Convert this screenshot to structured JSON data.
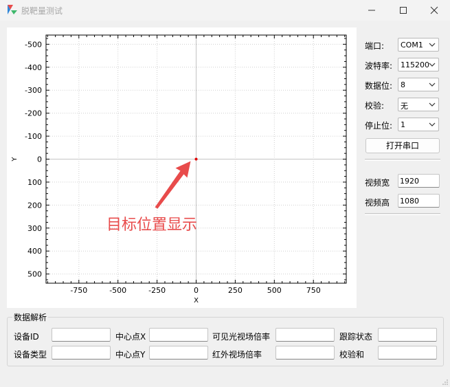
{
  "window": {
    "title": "脱靶量测试"
  },
  "chart_data": {
    "type": "scatter",
    "title": "",
    "xlabel": "X",
    "ylabel": "Y",
    "xlim": [
      -960,
      960
    ],
    "ylim": [
      540,
      -540
    ],
    "y_inverted": true,
    "grid": true,
    "xticks": [
      -750,
      -500,
      -250,
      0,
      250,
      500,
      750
    ],
    "yticks": [
      -500,
      -400,
      -300,
      -200,
      -100,
      0,
      100,
      200,
      300,
      400,
      500
    ],
    "points": [
      {
        "x": 0,
        "y": 0
      }
    ],
    "annotation": "目标位置显示",
    "annotation_color": "#e84b4b",
    "point_color": "#e00000"
  },
  "serial": {
    "port_label": "端口:",
    "port_value": "COM1",
    "baud_label": "波特率:",
    "baud_value": "115200",
    "databits_label": "数据位:",
    "databits_value": "8",
    "parity_label": "校验:",
    "parity_value": "无",
    "stopbits_label": "停止位:",
    "stopbits_value": "1",
    "open_button": "打开串口"
  },
  "video": {
    "width_label": "视频宽",
    "width_value": "1920",
    "height_label": "视频高",
    "height_value": "1080"
  },
  "parse": {
    "group_title": "数据解析",
    "device_id_label": "设备ID",
    "center_x_label": "中心点X",
    "visible_zoom_label": "可见光视场倍率",
    "track_status_label": "跟踪状态",
    "device_type_label": "设备类型",
    "center_y_label": "中心点Y",
    "ir_zoom_label": "红外视场倍率",
    "checksum_label": "校验和"
  }
}
